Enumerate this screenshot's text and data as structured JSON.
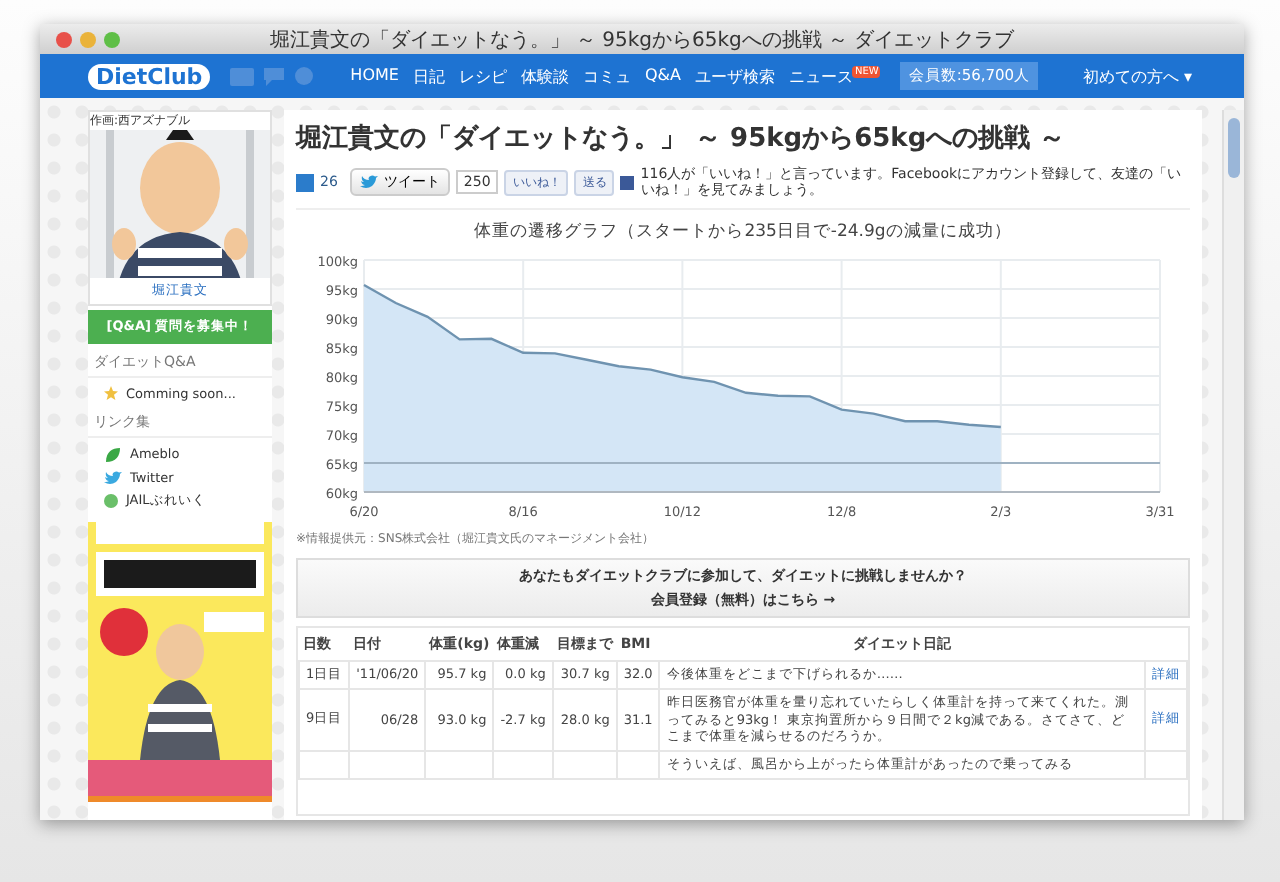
{
  "window": {
    "title": "堀江貴文の「ダイエットなう。」 ～ 95kgから65kgへの挑戦 ～ ダイエットクラブ"
  },
  "nav": {
    "logo": "DietClub",
    "items": [
      {
        "label": "HOME"
      },
      {
        "label": "日記"
      },
      {
        "label": "レシピ"
      },
      {
        "label": "体験談"
      },
      {
        "label": "コミュ"
      },
      {
        "label": "Q&A"
      },
      {
        "label": "ユーザ検索"
      },
      {
        "label": "ニュース",
        "badge": "NEW"
      }
    ],
    "members": "会員数:56,700人",
    "guide": "初めての方へ",
    "guide_caret": "▾"
  },
  "sidebar": {
    "credit": "作画:西アズナブル",
    "name": "堀江貴文",
    "qa_button": "[Q&A] 質問を募集中！",
    "sections": [
      {
        "title": "ダイエットQ&A",
        "items": [
          {
            "label": "Comming soon...",
            "kind": "star"
          }
        ]
      },
      {
        "title": "リンク集",
        "items": [
          {
            "label": "Ameblo",
            "kind": "ameblo"
          },
          {
            "label": "Twitter",
            "kind": "twitter"
          },
          {
            "label": "JAILぶれいく",
            "kind": "jail"
          }
        ]
      }
    ]
  },
  "article": {
    "title": "堀江貴文の「ダイエットなう。」 ～ 95kgから65kgへの挑戦 ～",
    "social": {
      "hatena_count": "26",
      "tweet": "ツイート",
      "tweet_count": "250",
      "like": "いいね！",
      "send": "送る",
      "fb_text": "116人が「いいね！」と言っています。Facebookにアカウント登録して、友達の「いいね！」を見てみましょう。"
    },
    "chart_heading": "体重の遷移グラフ（スタートから235日目で-24.9gの減量に成功）",
    "chart_data": {
      "type": "area",
      "categories": [
        "6/20",
        null,
        null,
        null,
        null,
        "8/16",
        null,
        null,
        null,
        null,
        "10/12",
        null,
        null,
        null,
        null,
        "12/8",
        null,
        null,
        null,
        null,
        "2/3",
        null,
        null,
        null,
        null,
        "3/31"
      ],
      "series": [
        {
          "color": "#6f93b0",
          "values": [
            95.7,
            92.6,
            90.2,
            86.3,
            86.4,
            84.0,
            83.9,
            82.8,
            81.7,
            81.1,
            79.8,
            79.0,
            77.1,
            76.6,
            76.5,
            74.2,
            73.5,
            72.2,
            72.2,
            71.6,
            71.2,
            null,
            null,
            null,
            null,
            null
          ]
        }
      ],
      "ylim": [
        60,
        100
      ],
      "grid": true,
      "yticks": [
        {
          "value": 100,
          "label": "100kg"
        },
        {
          "value": 95,
          "label": "95kg"
        },
        {
          "value": 90,
          "label": "90kg"
        },
        {
          "value": 85,
          "label": "85kg"
        },
        {
          "value": 80,
          "label": "80kg"
        },
        {
          "value": 75,
          "label": "75kg"
        },
        {
          "value": 70,
          "label": "70kg"
        },
        {
          "value": 65,
          "label": "65kg"
        },
        {
          "value": 60,
          "label": "60kg"
        }
      ],
      "ref_lines": [
        {
          "axis": "y",
          "value": 65
        }
      ]
    },
    "source_note": "※情報提供元：SNS株式会社（堀江貴文氏のマネージメント会社）",
    "cta": {
      "line1": "あなたもダイエットクラブに参加して、ダイエットに挑戦しませんか？",
      "line2": "会員登録（無料）はこちら →"
    },
    "table": {
      "columns": [
        "日数",
        "日付",
        "体重(kg)",
        "体重減",
        "目標まで",
        "BMI",
        "ダイエット日記"
      ],
      "rows": [
        {
          "cells": [
            "1日目",
            "'11/06/20",
            "95.7 kg",
            "0.0 kg",
            "30.7 kg",
            "32.0",
            "今後体重をどこまで下げられるか……"
          ],
          "link": "詳細"
        },
        {
          "cells": [
            "9日目",
            "06/28",
            "93.0 kg",
            "-2.7 kg",
            "28.0 kg",
            "31.1",
            "昨日医務官が体重を量り忘れていたらしく体重計を持って来てくれた。測ってみると93kg！ 東京拘置所から９日間で２kg減である。さてさて、どこまで体重を減らせるのだろうか。"
          ],
          "link": "詳細"
        },
        {
          "cells": [
            "",
            "",
            "",
            "",
            "",
            "",
            "そういえば、風呂から上がったら体重計があったので乗ってみる"
          ]
        }
      ]
    }
  }
}
